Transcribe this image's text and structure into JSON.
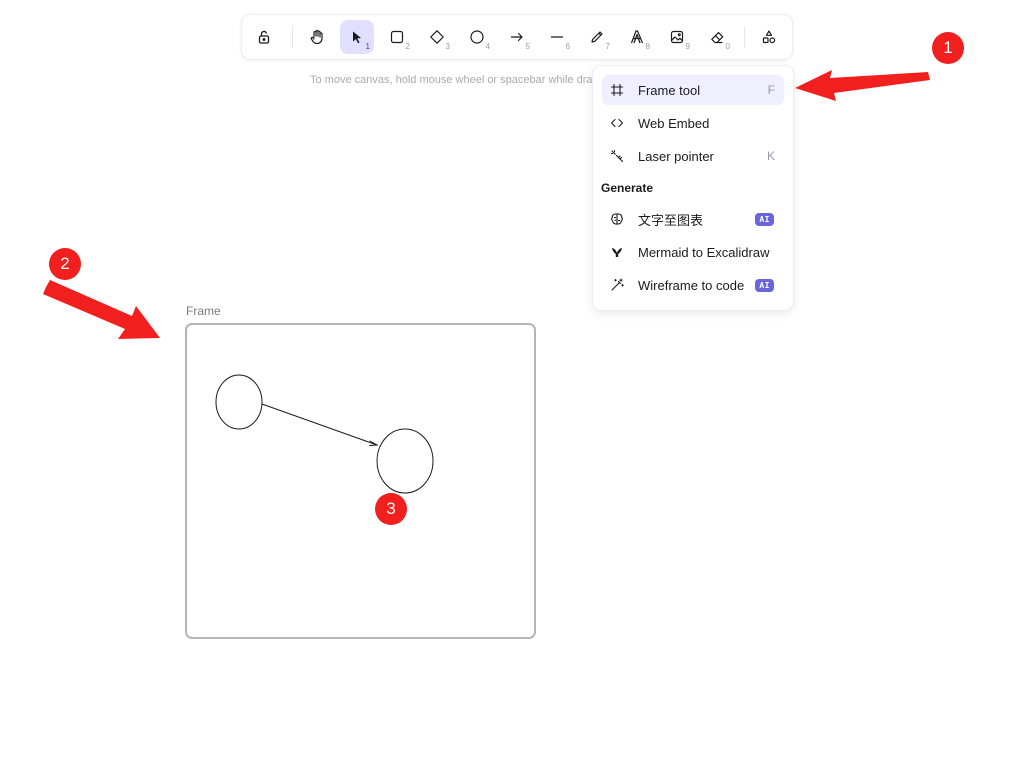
{
  "toolbar": {
    "tools": [
      {
        "name": "lock-tool",
        "key": ""
      },
      {
        "name": "hand-tool",
        "key": ""
      },
      {
        "name": "selection-tool",
        "key": "1",
        "active": true
      },
      {
        "name": "rectangle-tool",
        "key": "2"
      },
      {
        "name": "diamond-tool",
        "key": "3"
      },
      {
        "name": "ellipse-tool",
        "key": "4"
      },
      {
        "name": "arrow-tool",
        "key": "5"
      },
      {
        "name": "line-tool",
        "key": "6"
      },
      {
        "name": "draw-tool",
        "key": "7"
      },
      {
        "name": "text-tool",
        "key": "8"
      },
      {
        "name": "image-tool",
        "key": "9"
      },
      {
        "name": "eraser-tool",
        "key": "0"
      },
      {
        "name": "more-tools",
        "key": ""
      }
    ],
    "active_color": "#e0dfff"
  },
  "hint": "To move canvas, hold mouse wheel or spacebar while dra",
  "menu": {
    "items": [
      {
        "label": "Frame tool",
        "shortcut": "F",
        "icon": "frame-icon"
      },
      {
        "label": "Web Embed",
        "shortcut": "",
        "icon": "code-icon"
      },
      {
        "label": "Laser pointer",
        "shortcut": "K",
        "icon": "laser-icon"
      }
    ],
    "section_title": "Generate",
    "generate": [
      {
        "label": "文字至图表",
        "badge": "AI",
        "icon": "brain-icon"
      },
      {
        "label": "Mermaid to Excalidraw",
        "badge": "",
        "icon": "mermaid-icon"
      },
      {
        "label": "Wireframe to code",
        "badge": "AI",
        "icon": "magic-wand-icon"
      }
    ],
    "highlight_color": "#f0efff",
    "badge_color": "#6965db"
  },
  "canvas": {
    "frame_label": "Frame"
  },
  "annotations": {
    "markers": [
      "1",
      "2",
      "3"
    ],
    "color": "#f21f1f"
  }
}
